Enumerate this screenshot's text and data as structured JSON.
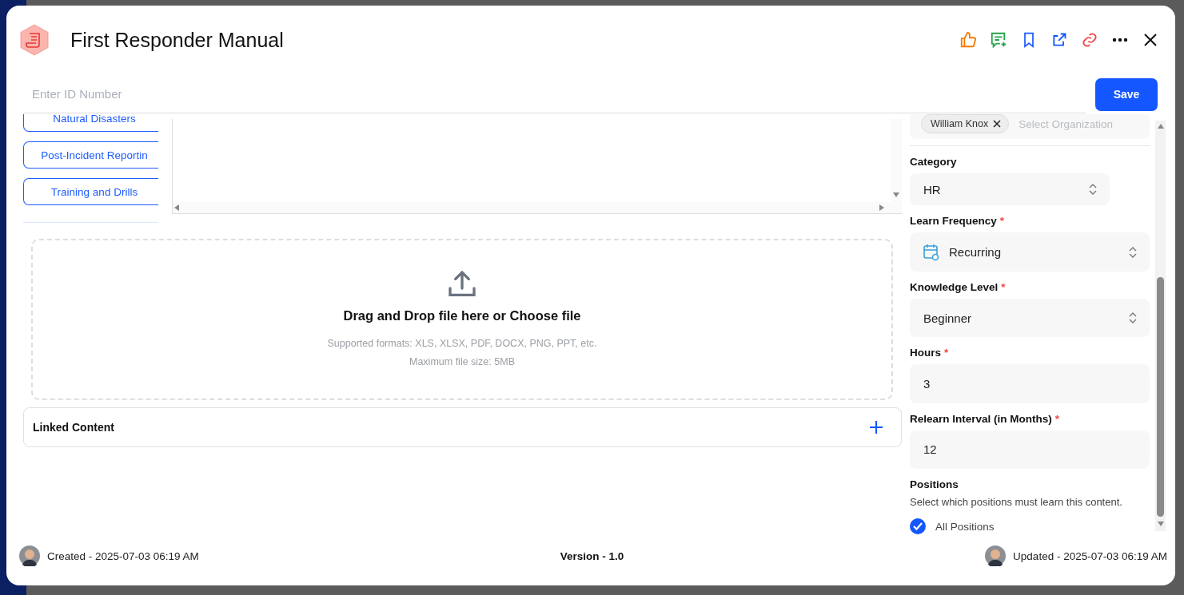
{
  "header": {
    "title": "First Responder Manual"
  },
  "id_field": {
    "placeholder": "Enter ID Number"
  },
  "save_button": "Save",
  "topics": [
    {
      "label": "Natural Disasters"
    },
    {
      "label": "Post-Incident Reportin"
    },
    {
      "label": "Training and Drills"
    }
  ],
  "upload": {
    "title": "Drag and Drop file here or Choose file",
    "formats": "Supported formats: XLS, XLSX, PDF, DOCX, PNG, PPT, etc.",
    "max_size": "Maximum file size: 5MB"
  },
  "linked_content": {
    "title": "Linked Content"
  },
  "organization": {
    "tags": [
      "William Knox"
    ],
    "placeholder": "Select Organization"
  },
  "fields": [
    {
      "kind": "short-select",
      "label": "Category",
      "value": "HR"
    },
    {
      "kind": "schedule-select",
      "label": "Learn Frequency",
      "required_mark": "*",
      "value": "Recurring"
    },
    {
      "kind": "select",
      "label": "Knowledge Level",
      "required_mark": "*",
      "value": "Beginner"
    },
    {
      "kind": "input",
      "label": "Hours",
      "required_mark": "*",
      "value": "3"
    },
    {
      "kind": "input",
      "label": "Relearn Interval (in Months)",
      "required_mark": "*",
      "value": "12"
    }
  ],
  "positions": {
    "title": "Positions",
    "hint": "Select which positions must learn this content.",
    "options": [
      {
        "label": "All Positions",
        "checked": true
      }
    ]
  },
  "footer": {
    "created": "Created - 2025-07-03 06:19 AM",
    "version": "Version - 1.0",
    "updated": "Updated - 2025-07-03 06:19 AM"
  }
}
